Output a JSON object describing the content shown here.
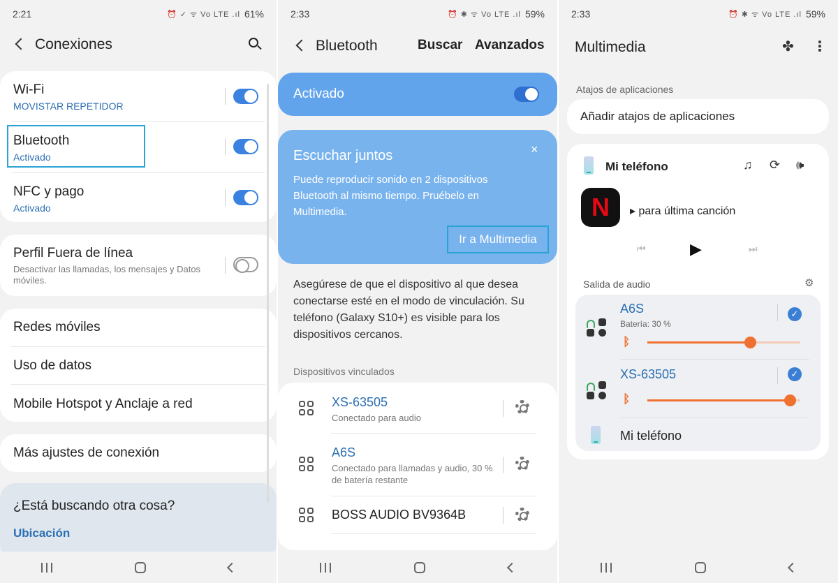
{
  "p1": {
    "time": "2:21",
    "status_icons": "⏰ ✓ ᯤ Vo LTE .ıl",
    "battery": "61%",
    "header_title": "Conexiones",
    "wifi": {
      "title": "Wi-Fi",
      "sub": "MOVISTAR REPETIDOR"
    },
    "bluetooth": {
      "title": "Bluetooth",
      "sub": "Activado"
    },
    "nfc": {
      "title": "NFC y pago",
      "sub": "Activado"
    },
    "offline": {
      "title": "Perfil Fuera de línea",
      "sub": "Desactivar las llamadas, los mensajes y Datos móviles."
    },
    "mobile_networks": "Redes móviles",
    "data_usage": "Uso de datos",
    "hotspot": "Mobile Hotspot y Anclaje a red",
    "more": "Más ajustes de conexión",
    "looking_title": "¿Está buscando otra cosa?",
    "looking_link": "Ubicación"
  },
  "p2": {
    "time": "2:33",
    "status_icons": "⏰ ✱ ᯤ Vo LTE .ıl",
    "battery": "59%",
    "header_title": "Bluetooth",
    "search": "Buscar",
    "advanced": "Avanzados",
    "activated": "Activado",
    "listen_title": "Escuchar juntos",
    "listen_body": "Puede reproducir sonido en 2 dispositivos Bluetooth al mismo tiempo. Pruébelo en Multimedia.",
    "listen_button": "Ir a Multimedia",
    "info": "Asegúrese de que el dispositivo al que desea conectarse esté en el modo de vinculación. Su teléfono (Galaxy S10+) es visible para los dispositivos cercanos.",
    "paired_label": "Dispositivos vinculados",
    "devices": [
      {
        "name": "XS-63505",
        "sub": "Conectado para audio"
      },
      {
        "name": "A6S",
        "sub": "Conectado para llamadas y audio, 30 % de batería restante"
      },
      {
        "name": "BOSS AUDIO BV9364B",
        "sub": ""
      }
    ]
  },
  "p3": {
    "time": "2:33",
    "status_icons": "⏰ ✱ ᯤ Vo LTE .ıl",
    "battery": "59%",
    "header_title": "Multimedia",
    "shortcuts_label": "Atajos de aplicaciones",
    "add_shortcuts": "Añadir atajos de aplicaciones",
    "my_phone": "Mi teléfono",
    "track": "▸ para última canción",
    "app_letter": "N",
    "audio_output_label": "Salida de audio",
    "outputs": [
      {
        "name": "A6S",
        "sub": "Batería: 30 %",
        "volume": 0.67
      },
      {
        "name": "XS-63505",
        "sub": "",
        "volume": 0.93
      }
    ],
    "phone_output": "Mi teléfono"
  },
  "colors": {
    "accent": "#3b82e0",
    "orange": "#ef7130",
    "blue_card": "#62a4ec",
    "link": "#2b6fb3",
    "netflix": "#e50914"
  }
}
